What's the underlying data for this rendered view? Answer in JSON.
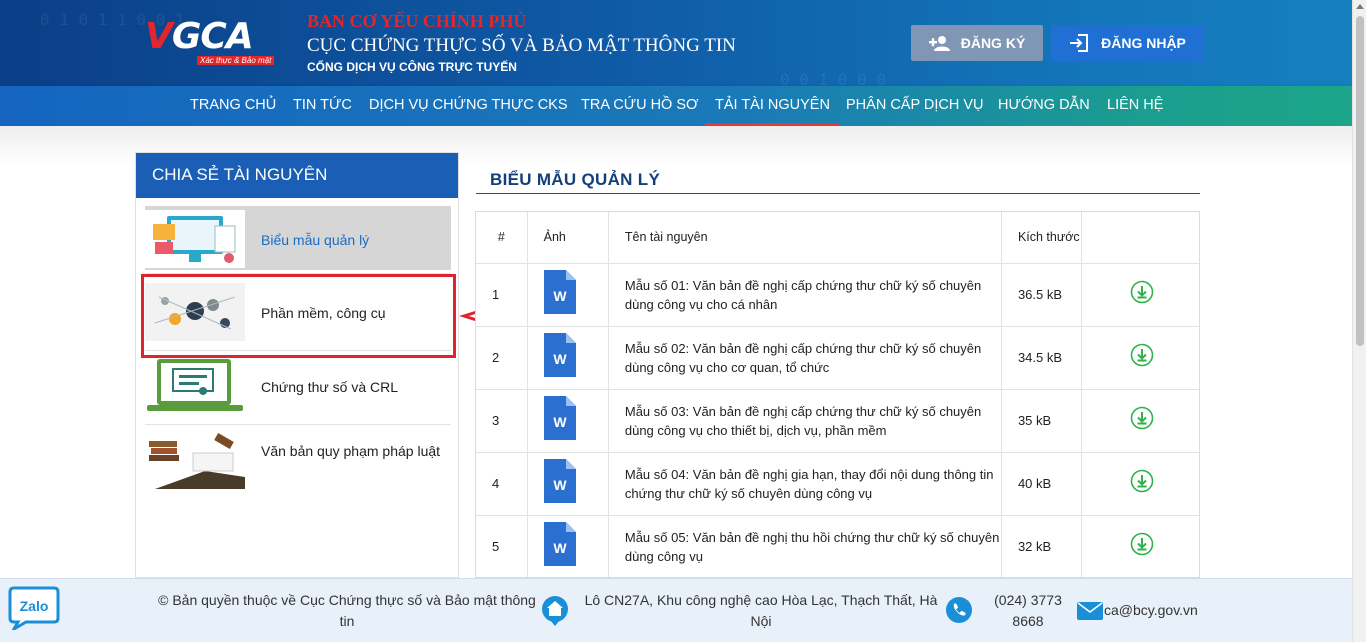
{
  "header": {
    "logo_main": "VGCA",
    "logo_sub": "Xác thực & Bảo mật",
    "org_line1": "BAN CƠ YẾU CHÍNH PHỦ",
    "org_line2": "CỤC CHỨNG THỰC SỐ VÀ BẢO MẬT THÔNG TIN",
    "org_line3": "CỔNG DỊCH VỤ CÔNG TRỰC TUYẾN",
    "register_label": "ĐĂNG KÝ",
    "login_label": "ĐĂNG NHẬP"
  },
  "nav": {
    "items": [
      {
        "label": "TRANG CHỦ"
      },
      {
        "label": "TIN TỨC"
      },
      {
        "label": "DỊCH VỤ CHỨNG THỰC CKS"
      },
      {
        "label": "TRA CỨU HỒ SƠ"
      },
      {
        "label": "TẢI TÀI NGUYÊN"
      },
      {
        "label": "PHÂN CẤP DỊCH VỤ"
      },
      {
        "label": "HƯỚNG DẪN"
      },
      {
        "label": "LIÊN HỆ"
      }
    ],
    "active_index": 4
  },
  "sidebar": {
    "title": "CHIA SẺ TÀI NGUYÊN",
    "items": [
      {
        "label": "Biểu mẫu quản lý"
      },
      {
        "label": "Phần mềm, công cụ"
      },
      {
        "label": "Chứng thư số và CRL"
      },
      {
        "label": "Văn bản quy phạm pháp luật"
      }
    ]
  },
  "main": {
    "title": "BIỂU MẪU QUẢN LÝ",
    "columns": [
      "#",
      "Ảnh",
      "Tên tài nguyên",
      "Kích thước",
      ""
    ],
    "rows": [
      {
        "num": "1",
        "name": "Mẫu số 01: Văn bản đề nghị cấp chứng thư chữ ký số chuyên dùng công vụ cho cá nhân",
        "size": "36.5 kB"
      },
      {
        "num": "2",
        "name": "Mẫu số 02: Văn bản đề nghị cấp chứng thư chữ ký số chuyên dùng công vụ cho cơ quan, tổ chức",
        "size": "34.5 kB"
      },
      {
        "num": "3",
        "name": "Mẫu số 03: Văn bản đề nghị cấp chứng thư chữ ký số chuyên dùng công vụ cho thiết bị, dịch vụ, phần mềm",
        "size": "35 kB"
      },
      {
        "num": "4",
        "name": "Mẫu số 04: Văn bản đề nghị gia hạn, thay đổi nội dung thông tin chứng thư chữ ký số chuyên dùng công vụ",
        "size": "40 kB"
      },
      {
        "num": "5",
        "name": "Mẫu số 05: Văn bản đề nghị thu hồi chứng thư chữ ký số chuyên dùng công vụ",
        "size": "32 kB"
      }
    ],
    "file_icon_letter": "W"
  },
  "footer": {
    "copyright": "© Bản quyền thuộc về Cục Chứng thực số và Bảo mật thông tin",
    "address": "Lô CN27A, Khu công nghệ cao Hòa Lạc, Thạch Thất, Hà Nội",
    "phone": "(024) 3773 8668",
    "email": "ca@bcy.gov.vn",
    "zalo_label": "Zalo"
  },
  "colors": {
    "brand_blue": "#1a5eb5",
    "accent_red": "#e0242d",
    "download_green": "#2eb24a",
    "word_blue": "#2b6fd0"
  }
}
